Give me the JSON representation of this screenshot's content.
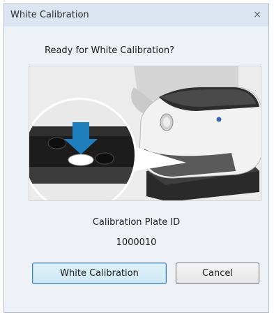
{
  "dialog": {
    "title": "White Calibration",
    "close_glyph": "×"
  },
  "prompt": "Ready for White Calibration?",
  "illustration": {
    "icon": "spectrophotometer-on-calibration-plate-icon",
    "arrow_color": "#1f7fbd"
  },
  "plate": {
    "label": "Calibration Plate ID",
    "id": "1000010"
  },
  "buttons": {
    "calibrate_label": "White Calibration",
    "cancel_label": "Cancel"
  }
}
